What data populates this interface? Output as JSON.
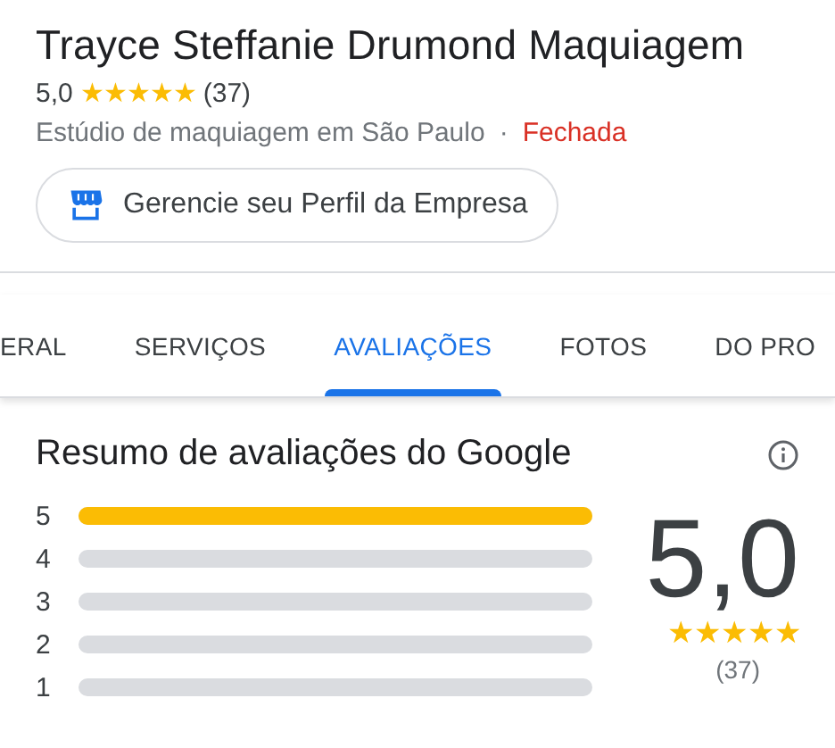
{
  "business": {
    "name": "Trayce Steffanie Drumond Maquiagem",
    "rating": "5,0",
    "stars": 5,
    "review_count": "(37)",
    "category": "Estúdio de maquiagem em São Paulo",
    "separator": "·",
    "status": "Fechada",
    "manage_button": "Gerencie seu Perfil da Empresa"
  },
  "tabs": [
    {
      "label": "ERAL",
      "selected": false
    },
    {
      "label": "SERVIÇOS",
      "selected": false
    },
    {
      "label": "AVALIAÇÕES",
      "selected": true
    },
    {
      "label": "FOTOS",
      "selected": false
    },
    {
      "label": "DO PRO",
      "selected": false
    }
  ],
  "summary": {
    "title": "Resumo de avaliações do Google",
    "score": "5,0",
    "stars": 5,
    "count": "(37)",
    "bars": [
      {
        "label": "5",
        "level": 1
      },
      {
        "label": "4"
      },
      {
        "label": "3"
      },
      {
        "label": "2"
      },
      {
        "label": "1"
      }
    ]
  }
}
